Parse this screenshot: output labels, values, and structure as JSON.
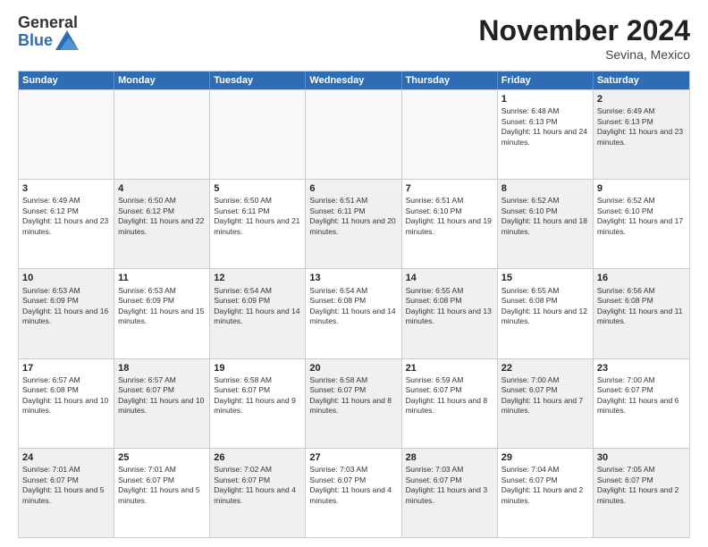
{
  "logo": {
    "general": "General",
    "blue": "Blue"
  },
  "title": "November 2024",
  "location": "Sevina, Mexico",
  "days_of_week": [
    "Sunday",
    "Monday",
    "Tuesday",
    "Wednesday",
    "Thursday",
    "Friday",
    "Saturday"
  ],
  "weeks": [
    [
      {
        "day": "",
        "empty": true
      },
      {
        "day": "",
        "empty": true
      },
      {
        "day": "",
        "empty": true
      },
      {
        "day": "",
        "empty": true
      },
      {
        "day": "",
        "empty": true
      },
      {
        "day": "1",
        "sunrise": "Sunrise: 6:48 AM",
        "sunset": "Sunset: 6:13 PM",
        "daylight": "Daylight: 11 hours and 24 minutes.",
        "shaded": false
      },
      {
        "day": "2",
        "sunrise": "Sunrise: 6:49 AM",
        "sunset": "Sunset: 6:13 PM",
        "daylight": "Daylight: 11 hours and 23 minutes.",
        "shaded": true
      }
    ],
    [
      {
        "day": "3",
        "sunrise": "Sunrise: 6:49 AM",
        "sunset": "Sunset: 6:12 PM",
        "daylight": "Daylight: 11 hours and 23 minutes.",
        "shaded": false
      },
      {
        "day": "4",
        "sunrise": "Sunrise: 6:50 AM",
        "sunset": "Sunset: 6:12 PM",
        "daylight": "Daylight: 11 hours and 22 minutes.",
        "shaded": true
      },
      {
        "day": "5",
        "sunrise": "Sunrise: 6:50 AM",
        "sunset": "Sunset: 6:11 PM",
        "daylight": "Daylight: 11 hours and 21 minutes.",
        "shaded": false
      },
      {
        "day": "6",
        "sunrise": "Sunrise: 6:51 AM",
        "sunset": "Sunset: 6:11 PM",
        "daylight": "Daylight: 11 hours and 20 minutes.",
        "shaded": true
      },
      {
        "day": "7",
        "sunrise": "Sunrise: 6:51 AM",
        "sunset": "Sunset: 6:10 PM",
        "daylight": "Daylight: 11 hours and 19 minutes.",
        "shaded": false
      },
      {
        "day": "8",
        "sunrise": "Sunrise: 6:52 AM",
        "sunset": "Sunset: 6:10 PM",
        "daylight": "Daylight: 11 hours and 18 minutes.",
        "shaded": true
      },
      {
        "day": "9",
        "sunrise": "Sunrise: 6:52 AM",
        "sunset": "Sunset: 6:10 PM",
        "daylight": "Daylight: 11 hours and 17 minutes.",
        "shaded": false
      }
    ],
    [
      {
        "day": "10",
        "sunrise": "Sunrise: 6:53 AM",
        "sunset": "Sunset: 6:09 PM",
        "daylight": "Daylight: 11 hours and 16 minutes.",
        "shaded": true
      },
      {
        "day": "11",
        "sunrise": "Sunrise: 6:53 AM",
        "sunset": "Sunset: 6:09 PM",
        "daylight": "Daylight: 11 hours and 15 minutes.",
        "shaded": false
      },
      {
        "day": "12",
        "sunrise": "Sunrise: 6:54 AM",
        "sunset": "Sunset: 6:09 PM",
        "daylight": "Daylight: 11 hours and 14 minutes.",
        "shaded": true
      },
      {
        "day": "13",
        "sunrise": "Sunrise: 6:54 AM",
        "sunset": "Sunset: 6:08 PM",
        "daylight": "Daylight: 11 hours and 14 minutes.",
        "shaded": false
      },
      {
        "day": "14",
        "sunrise": "Sunrise: 6:55 AM",
        "sunset": "Sunset: 6:08 PM",
        "daylight": "Daylight: 11 hours and 13 minutes.",
        "shaded": true
      },
      {
        "day": "15",
        "sunrise": "Sunrise: 6:55 AM",
        "sunset": "Sunset: 6:08 PM",
        "daylight": "Daylight: 11 hours and 12 minutes.",
        "shaded": false
      },
      {
        "day": "16",
        "sunrise": "Sunrise: 6:56 AM",
        "sunset": "Sunset: 6:08 PM",
        "daylight": "Daylight: 11 hours and 11 minutes.",
        "shaded": true
      }
    ],
    [
      {
        "day": "17",
        "sunrise": "Sunrise: 6:57 AM",
        "sunset": "Sunset: 6:08 PM",
        "daylight": "Daylight: 11 hours and 10 minutes.",
        "shaded": false
      },
      {
        "day": "18",
        "sunrise": "Sunrise: 6:57 AM",
        "sunset": "Sunset: 6:07 PM",
        "daylight": "Daylight: 11 hours and 10 minutes.",
        "shaded": true
      },
      {
        "day": "19",
        "sunrise": "Sunrise: 6:58 AM",
        "sunset": "Sunset: 6:07 PM",
        "daylight": "Daylight: 11 hours and 9 minutes.",
        "shaded": false
      },
      {
        "day": "20",
        "sunrise": "Sunrise: 6:58 AM",
        "sunset": "Sunset: 6:07 PM",
        "daylight": "Daylight: 11 hours and 8 minutes.",
        "shaded": true
      },
      {
        "day": "21",
        "sunrise": "Sunrise: 6:59 AM",
        "sunset": "Sunset: 6:07 PM",
        "daylight": "Daylight: 11 hours and 8 minutes.",
        "shaded": false
      },
      {
        "day": "22",
        "sunrise": "Sunrise: 7:00 AM",
        "sunset": "Sunset: 6:07 PM",
        "daylight": "Daylight: 11 hours and 7 minutes.",
        "shaded": true
      },
      {
        "day": "23",
        "sunrise": "Sunrise: 7:00 AM",
        "sunset": "Sunset: 6:07 PM",
        "daylight": "Daylight: 11 hours and 6 minutes.",
        "shaded": false
      }
    ],
    [
      {
        "day": "24",
        "sunrise": "Sunrise: 7:01 AM",
        "sunset": "Sunset: 6:07 PM",
        "daylight": "Daylight: 11 hours and 5 minutes.",
        "shaded": true
      },
      {
        "day": "25",
        "sunrise": "Sunrise: 7:01 AM",
        "sunset": "Sunset: 6:07 PM",
        "daylight": "Daylight: 11 hours and 5 minutes.",
        "shaded": false
      },
      {
        "day": "26",
        "sunrise": "Sunrise: 7:02 AM",
        "sunset": "Sunset: 6:07 PM",
        "daylight": "Daylight: 11 hours and 4 minutes.",
        "shaded": true
      },
      {
        "day": "27",
        "sunrise": "Sunrise: 7:03 AM",
        "sunset": "Sunset: 6:07 PM",
        "daylight": "Daylight: 11 hours and 4 minutes.",
        "shaded": false
      },
      {
        "day": "28",
        "sunrise": "Sunrise: 7:03 AM",
        "sunset": "Sunset: 6:07 PM",
        "daylight": "Daylight: 11 hours and 3 minutes.",
        "shaded": true
      },
      {
        "day": "29",
        "sunrise": "Sunrise: 7:04 AM",
        "sunset": "Sunset: 6:07 PM",
        "daylight": "Daylight: 11 hours and 2 minutes.",
        "shaded": false
      },
      {
        "day": "30",
        "sunrise": "Sunrise: 7:05 AM",
        "sunset": "Sunset: 6:07 PM",
        "daylight": "Daylight: 11 hours and 2 minutes.",
        "shaded": true
      }
    ]
  ]
}
